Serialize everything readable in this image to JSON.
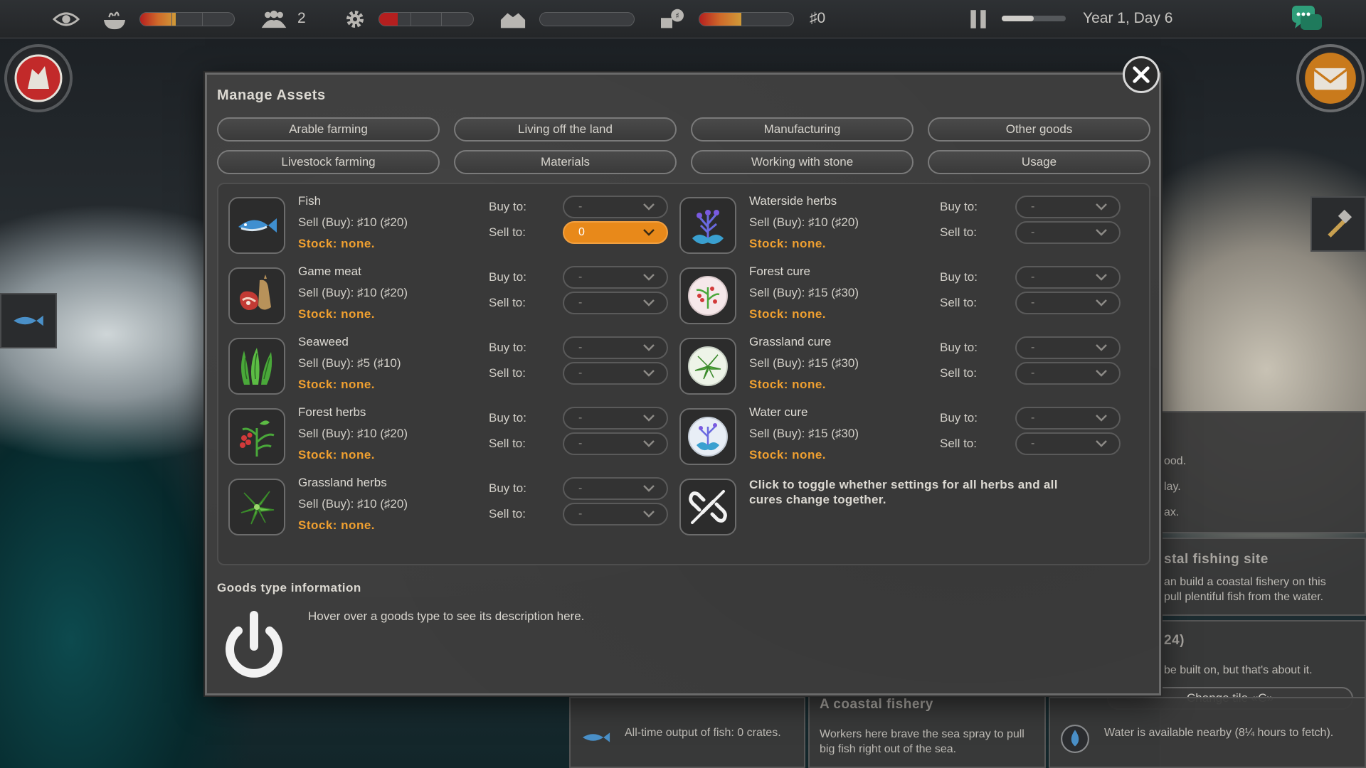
{
  "topbar": {
    "population": "2",
    "money": "♯0",
    "date": "Year 1, Day 6"
  },
  "colors": {
    "accent_orange": "#e8891a",
    "stock_orange": "#f0a030",
    "panel_bg": "#3d3d3d"
  },
  "dialog": {
    "title": "Manage Assets",
    "tabs": [
      "Arable farming",
      "Living off the land",
      "Manufacturing",
      "Other goods",
      "Livestock farming",
      "Materials",
      "Working with stone",
      "Usage"
    ],
    "buy_label": "Buy to:",
    "sell_label": "Sell to:",
    "goods_left": [
      {
        "name": "Fish",
        "price": "Sell (Buy): ♯10 (♯20)",
        "stock": "Stock: none.",
        "buy": "-",
        "sell": "0",
        "icon": "fish-icon"
      },
      {
        "name": "Game meat",
        "price": "Sell (Buy): ♯10 (♯20)",
        "stock": "Stock: none.",
        "buy": "-",
        "sell": "-",
        "icon": "game-meat-icon"
      },
      {
        "name": "Seaweed",
        "price": "Sell (Buy): ♯5 (♯10)",
        "stock": "Stock: none.",
        "buy": "-",
        "sell": "-",
        "icon": "seaweed-icon"
      },
      {
        "name": "Forest herbs",
        "price": "Sell (Buy): ♯10 (♯20)",
        "stock": "Stock: none.",
        "buy": "-",
        "sell": "-",
        "icon": "forest-herbs-icon"
      },
      {
        "name": "Grassland herbs",
        "price": "Sell (Buy): ♯10 (♯20)",
        "stock": "Stock: none.",
        "buy": "-",
        "sell": "-",
        "icon": "grassland-herbs-icon"
      }
    ],
    "goods_right": [
      {
        "name": "Waterside herbs",
        "price": "Sell (Buy): ♯10 (♯20)",
        "stock": "Stock: none.",
        "buy": "-",
        "sell": "-",
        "icon": "waterside-herbs-icon"
      },
      {
        "name": "Forest cure",
        "price": "Sell (Buy): ♯15 (♯30)",
        "stock": "Stock: none.",
        "buy": "-",
        "sell": "-",
        "icon": "forest-cure-icon"
      },
      {
        "name": "Grassland cure",
        "price": "Sell (Buy): ♯15 (♯30)",
        "stock": "Stock: none.",
        "buy": "-",
        "sell": "-",
        "icon": "grassland-cure-icon"
      },
      {
        "name": "Water cure",
        "price": "Sell (Buy): ♯15 (♯30)",
        "stock": "Stock: none.",
        "buy": "-",
        "sell": "-",
        "icon": "water-cure-icon"
      }
    ],
    "link_note": "Click to toggle whether settings for all herbs and all cures change together.",
    "info_title": "Goods type information",
    "info_text": "Hover over a goods type to see its description here."
  },
  "background_panels": {
    "partial_lines": [
      "ood.",
      "lay.",
      "ax."
    ],
    "site_title": "stal fishing site",
    "site_text_1": "an build a coastal fishery on this",
    "site_text_2": "pull plentiful fish from the water.",
    "tile_title": "24)",
    "tile_text": "be built on, but that's about it.",
    "change_tile": "Change tile «C»",
    "fishery_output": "All-time output of fish: 0 crates.",
    "fishery_title": "A coastal fishery",
    "fishery_text": "Workers here brave the sea spray to pull big fish right out of the sea.",
    "water_text": "Water is available nearby (8¼ hours to fetch)."
  }
}
